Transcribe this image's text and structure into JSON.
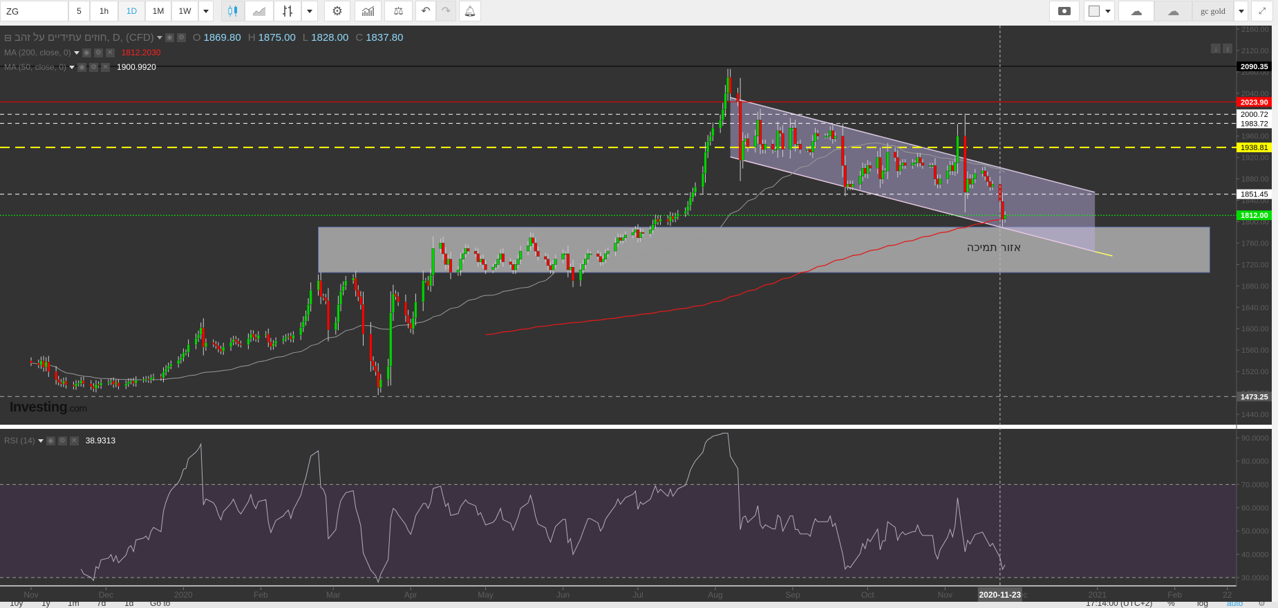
{
  "toolbar": {
    "symbol": "ZG",
    "intervals": [
      "5",
      "1h",
      "1D",
      "1M",
      "1W"
    ],
    "active_interval": "1D",
    "layout_name": "gc gold",
    "icons": [
      "candlestick-icon",
      "line-chart-icon",
      "bar-chart-icon",
      "gear-icon",
      "indicators-icon",
      "compare-scale-icon",
      "undo-icon",
      "redo-icon",
      "alert-icon",
      "camera-icon",
      "box-icon",
      "cloud-download-icon",
      "cloud-upload-icon",
      "fullscreen-icon"
    ]
  },
  "legend": {
    "instrument": "חוזים עתידיים על זהב, D, (CFD)",
    "o_label": "O",
    "open": "1869.80",
    "h_label": "H",
    "high": "1875.00",
    "l_label": "L",
    "low": "1828.00",
    "c_label": "C",
    "close": "1837.80",
    "ma200_label": "MA (200, close, 0)",
    "ma200_value": "1812.2030",
    "ma50_label": "MA (50, close, 0)",
    "ma50_value": "1900.9920",
    "rsi_label": "RSI (14)",
    "rsi_value": "38.9313"
  },
  "logo": {
    "brand": "Investing",
    "suffix": ".com"
  },
  "annotation": {
    "support_zone_label": "אזור תמיכה"
  },
  "crosshair": {
    "date_label": "2020-11-23"
  },
  "bottom_bar": {
    "ranges": [
      "10y",
      "1y",
      "1m",
      "7d",
      "1d",
      "Go to"
    ],
    "clock": "17:14:00 (UTC+2)",
    "percent": "%",
    "log": "log",
    "auto": "auto"
  },
  "colors": {
    "up": "#00d400",
    "down": "#ff0000",
    "ma200": "#e01b1b",
    "ma50": "#9a9a9a",
    "rsi": "#b4aebb",
    "accent": "#29a3e0"
  },
  "chart_data": [
    {
      "type": "candlestick",
      "title": "חוזים עתידיים על זהב, D, (CFD)",
      "start_date": "2019-11-01",
      "ylim": [
        1440,
        2160
      ],
      "yticks": [
        2160,
        2120,
        2080,
        2040,
        2000,
        1960,
        1920,
        1880,
        1840,
        1800,
        1760,
        1720,
        1680,
        1640,
        1600,
        1560,
        1520,
        1480,
        1440
      ],
      "closes": [
        1536,
        1532,
        1540,
        1528,
        1538,
        1520,
        1505,
        1500,
        1497,
        1502,
        1495,
        1492,
        1497,
        1498,
        1503,
        1497,
        1492,
        1488,
        1496,
        1494,
        1499,
        1500,
        1502,
        1496,
        1499,
        1493,
        1497,
        1501,
        1502,
        1498,
        1504,
        1505,
        1506,
        1504,
        1508,
        1510,
        1508,
        1519,
        1525,
        1530,
        1534,
        1541,
        1546,
        1555,
        1556,
        1570,
        1582,
        1589,
        1602,
        1566,
        1574,
        1571,
        1568,
        1562,
        1558,
        1566,
        1575,
        1580,
        1576,
        1572,
        1570,
        1582,
        1590,
        1584,
        1581,
        1588,
        1590,
        1575,
        1567,
        1572,
        1577,
        1581,
        1584,
        1586,
        1581,
        1588,
        1602,
        1614,
        1625,
        1645,
        1672,
        1690,
        1660,
        1658,
        1652,
        1598,
        1612,
        1645,
        1670,
        1680,
        1690,
        1695,
        1672,
        1660,
        1645,
        1590,
        1540,
        1530,
        1520,
        1490,
        1505,
        1530,
        1630,
        1665,
        1660,
        1650,
        1625,
        1610,
        1600,
        1620,
        1650,
        1690,
        1690,
        1680,
        1700,
        1750,
        1760,
        1740,
        1720,
        1730,
        1705,
        1710,
        1730,
        1740,
        1750,
        1745,
        1740,
        1725,
        1730,
        1720,
        1710,
        1715,
        1720,
        1730,
        1740,
        1725,
        1720,
        1710,
        1720,
        1730,
        1745,
        1755,
        1770,
        1760,
        1745,
        1735,
        1730,
        1718,
        1710,
        1720,
        1730,
        1740,
        1740,
        1710,
        1715,
        1690,
        1710,
        1720,
        1730,
        1740,
        1740,
        1735,
        1725,
        1730,
        1740,
        1745,
        1760,
        1770,
        1765,
        1770,
        1775,
        1780,
        1785,
        1770,
        1780,
        1778,
        1785,
        1795,
        1805,
        1800,
        1805,
        1800,
        1810,
        1805,
        1810,
        1815,
        1820,
        1830,
        1845,
        1855,
        1865,
        1890,
        1930,
        1950,
        1960,
        1975,
        1990,
        2010,
        2040,
        2070,
        2040,
        2025,
        1915,
        1950,
        1955,
        1940,
        1960,
        1990,
        1945,
        1935,
        1945,
        1935,
        1935,
        1970,
        1965,
        1935,
        1975,
        1975,
        1945,
        1945,
        1935,
        1935,
        1930,
        1950,
        1965,
        1960,
        1960,
        1960,
        1970,
        1955,
        1960,
        1905,
        1865,
        1870,
        1865,
        1870,
        1885,
        1900,
        1890,
        1905,
        1900,
        1920,
        1880,
        1895,
        1895,
        1930,
        1920,
        1895,
        1905,
        1910,
        1905,
        1910,
        1910,
        1920,
        1910,
        1905,
        1905,
        1905,
        1880,
        1870,
        1880,
        1895,
        1905,
        1895,
        1910,
        1960,
        1855,
        1880,
        1870,
        1880,
        1890,
        1895,
        1885,
        1875,
        1865,
        1869.8,
        1837.8,
        1805,
        1812
      ],
      "moving_averages": [
        {
          "name": "MA (200, close, 0)",
          "period": 200
        },
        {
          "name": "MA (50, close, 0)",
          "period": 50
        }
      ],
      "levels": [
        {
          "value": 2090.35,
          "style": "solid",
          "color": "#000000",
          "badge_bg": "#000000",
          "badge_fg": "#ffffff"
        },
        {
          "value": 2023.9,
          "style": "solid",
          "color": "#ff0000",
          "badge_bg": "#ff0000",
          "badge_fg": "#ffffff"
        },
        {
          "value": 2000.72,
          "style": "dashed",
          "color": "#ffffff",
          "badge_bg": "#ffffff",
          "badge_fg": "#000000"
        },
        {
          "value": 1983.72,
          "style": "dashed",
          "color": "#ffffff",
          "badge_bg": "#ffffff",
          "badge_fg": "#000000"
        },
        {
          "value": 1938.81,
          "style": "dashed-thick",
          "color": "#ffff00",
          "badge_bg": "#ffff00",
          "badge_fg": "#000000"
        },
        {
          "value": 1851.45,
          "style": "dashed",
          "color": "#ffffff",
          "badge_bg": "#ffffff",
          "badge_fg": "#000000"
        },
        {
          "value": 1812.0,
          "style": "dotted",
          "color": "#00ff00",
          "badge_bg": "#00dd00",
          "badge_fg": "#ffffff"
        },
        {
          "value": 1473.25,
          "style": "dashed",
          "color": "#aaaaaa",
          "badge_bg": "#555555",
          "badge_fg": "#ffffff"
        }
      ],
      "support_zone": {
        "from_date": "2020-02-24",
        "to_date": "2021-02-15",
        "price_low": 1705,
        "price_high": 1790
      },
      "channel": {
        "from_date": "2020-08-07",
        "to_date": "2020-12-31",
        "upper_start": 2032,
        "upper_end": 1855,
        "lower_start": 1921,
        "lower_end": 1744,
        "extension_end_date": "2021-01-07",
        "extension_end_price": 1736
      }
    },
    {
      "type": "line",
      "title": "RSI (14)",
      "period": 14,
      "ylim": [
        28,
        92
      ],
      "yticks": [
        90,
        80,
        70,
        60,
        50,
        40,
        30
      ],
      "band": [
        30,
        70
      ]
    }
  ],
  "time_axis": [
    {
      "label": "Nov",
      "date": "2019-11-01"
    },
    {
      "label": "Dec",
      "date": "2019-12-01"
    },
    {
      "label": "2020",
      "date": "2020-01-01"
    },
    {
      "label": "Feb",
      "date": "2020-02-01"
    },
    {
      "label": "Mar",
      "date": "2020-03-01"
    },
    {
      "label": "Apr",
      "date": "2020-04-01"
    },
    {
      "label": "May",
      "date": "2020-05-01"
    },
    {
      "label": "Jun",
      "date": "2020-06-01"
    },
    {
      "label": "Jul",
      "date": "2020-07-01"
    },
    {
      "label": "Aug",
      "date": "2020-08-01"
    },
    {
      "label": "Sep",
      "date": "2020-09-01"
    },
    {
      "label": "Oct",
      "date": "2020-10-01"
    },
    {
      "label": "Nov",
      "date": "2020-11-01"
    },
    {
      "label": "Dec",
      "date": "2020-12-01"
    },
    {
      "label": "2021",
      "date": "2021-01-01"
    },
    {
      "label": "Feb",
      "date": "2021-02-01"
    },
    {
      "label": "22",
      "date": "2021-02-22"
    }
  ],
  "crosshair_date": "2020-11-23"
}
